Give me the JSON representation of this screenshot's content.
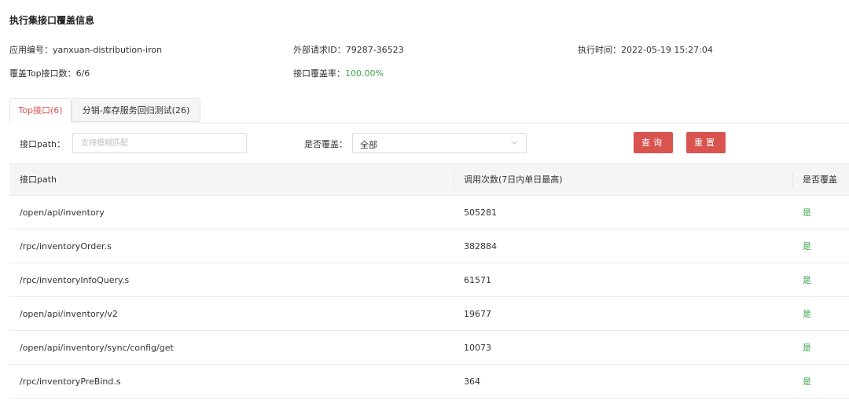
{
  "page": {
    "title": "执行集接口覆盖信息"
  },
  "info": {
    "app_id_label": "应用编号：",
    "app_id_value": "yanxuan-distribution-iron",
    "ext_req_label": "外部请求ID：",
    "ext_req_value": "79287-36523",
    "exec_time_label": "执行时间：",
    "exec_time_value": "2022-05-19 15:27:04",
    "top_count_label": "覆盖Top接口数：",
    "top_count_value": "6/6",
    "coverage_label": "接口覆盖率：",
    "coverage_value": "100.00%"
  },
  "colors": {
    "accent": "#d9534f",
    "success": "#3fa34d"
  },
  "tabs": [
    {
      "label": "Top接口(6)",
      "active": true
    },
    {
      "label": "分销-库存服务回归测试(26)",
      "active": false
    }
  ],
  "filters": {
    "path_label": "接口path：",
    "path_placeholder": "支持模糊匹配",
    "covered_label": "是否覆盖：",
    "covered_value": "全部",
    "query_label": "查询",
    "reset_label": "重置"
  },
  "table": {
    "columns": [
      "接口path",
      "调用次数(7日内单日最高)",
      "是否覆盖"
    ],
    "rows": [
      {
        "path": "/open/api/inventory",
        "calls": "505281",
        "covered": "是"
      },
      {
        "path": "/rpc/inventoryOrder.s",
        "calls": "382884",
        "covered": "是"
      },
      {
        "path": "/rpc/inventoryInfoQuery.s",
        "calls": "61571",
        "covered": "是"
      },
      {
        "path": "/open/api/inventory/v2",
        "calls": "19677",
        "covered": "是"
      },
      {
        "path": "/open/api/inventory/sync/config/get",
        "calls": "10073",
        "covered": "是"
      },
      {
        "path": "/rpc/inventoryPreBind.s",
        "calls": "364",
        "covered": "是"
      }
    ]
  }
}
